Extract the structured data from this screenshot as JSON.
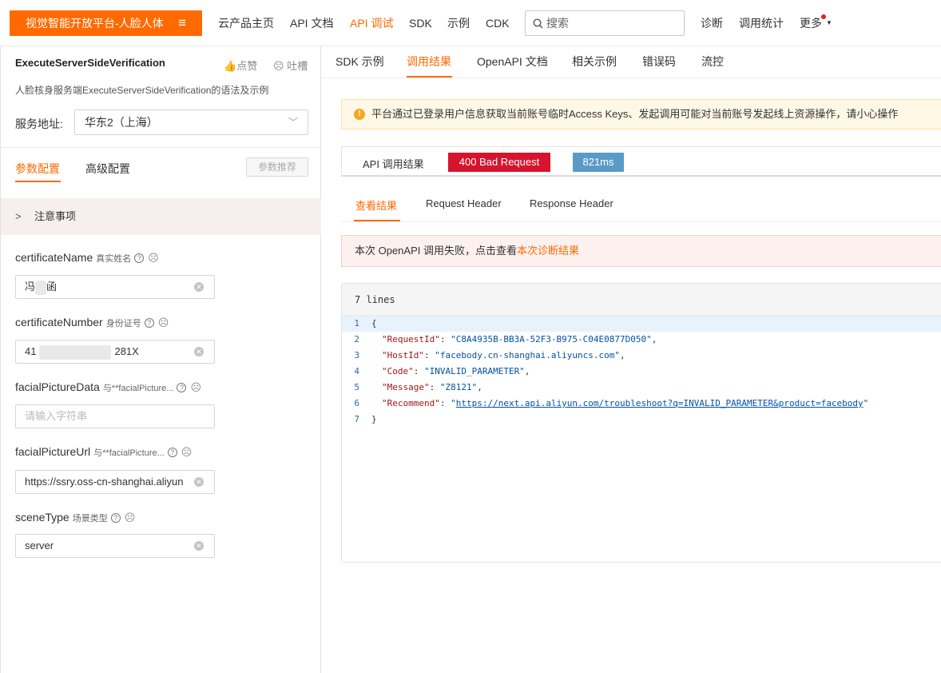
{
  "header": {
    "brand": "视觉智能开放平台-人脸人体",
    "menu_icon": "≡",
    "nav": [
      "云产品主页",
      "API 文档",
      "API 调试",
      "SDK",
      "示例",
      "CDK"
    ],
    "active_nav": "API 调试",
    "search_placeholder": "搜索",
    "right_nav": [
      "诊断",
      "调用统计",
      "更多"
    ]
  },
  "left": {
    "api_name": "ExecuteServerSideVerification",
    "like_label": "点赞",
    "dislike_label": "吐槽",
    "description": "人脸核身服务端ExecuteServerSideVerification的语法及示例",
    "service_label": "服务地址:",
    "service_value": "华东2（上海）",
    "tabs": [
      "参数配置",
      "高级配置"
    ],
    "recommend_label": "参数推荐",
    "notice_label": "注意事项",
    "fields": [
      {
        "name": "certificateName",
        "sub": "真实姓名",
        "value_prefix": "冯",
        "value_suffix": "函"
      },
      {
        "name": "certificateNumber",
        "sub": "身份证号",
        "value_prefix": "41",
        "value_suffix": "281X"
      },
      {
        "name": "facialPictureData",
        "sub": "与**facialPicture...",
        "placeholder": "请输入字符串"
      },
      {
        "name": "facialPictureUrl",
        "sub": "与**facialPicture...",
        "value": "https://ssry.oss-cn-shanghai.aliyun"
      },
      {
        "name": "sceneType",
        "sub": "场景类型",
        "value": "server"
      }
    ]
  },
  "right": {
    "tabs": [
      "SDK 示例",
      "调用结果",
      "OpenAPI 文档",
      "相关示例",
      "错误码",
      "流控"
    ],
    "active_tab": "调用结果",
    "warning": "平台通过已登录用户信息获取当前账号临时Access Keys、发起调用可能对当前账号发起线上资源操作，请小心操作",
    "result_label": "API 调用结果",
    "status": "400 Bad Request",
    "duration": "821ms",
    "sub_tabs": [
      "查看结果",
      "Request Header",
      "Response Header"
    ],
    "error_text": "本次 OpenAPI 调用失败，点击查看",
    "error_link": "本次诊断结果",
    "code_header": "7 lines",
    "code": {
      "line_numbers": [
        "1",
        "2",
        "3",
        "4",
        "5",
        "6",
        "7"
      ],
      "open_brace": "{",
      "close_brace": "}",
      "entries": [
        {
          "key": "\"RequestId\"",
          "value": "\"C8A4935B-BB3A-52F3-B975-C04E0877D050\"",
          "trail": ","
        },
        {
          "key": "\"HostId\"",
          "value": "\"facebody.cn-shanghai.aliyuncs.com\"",
          "trail": ","
        },
        {
          "key": "\"Code\"",
          "value": "\"INVALID_PARAMETER\"",
          "trail": ","
        },
        {
          "key": "\"Message\"",
          "value": "\"Z8121\"",
          "trail": ","
        },
        {
          "key": "\"Recommend\"",
          "value": "https://next.api.aliyun.com/troubleshoot?q=INVALID_PARAMETER&product=facebody",
          "quote": "\"",
          "trail": ""
        }
      ]
    }
  },
  "colors": {
    "accent": "#ff6a00",
    "error_badge": "#d6142e",
    "time_badge": "#5a9bc6"
  }
}
